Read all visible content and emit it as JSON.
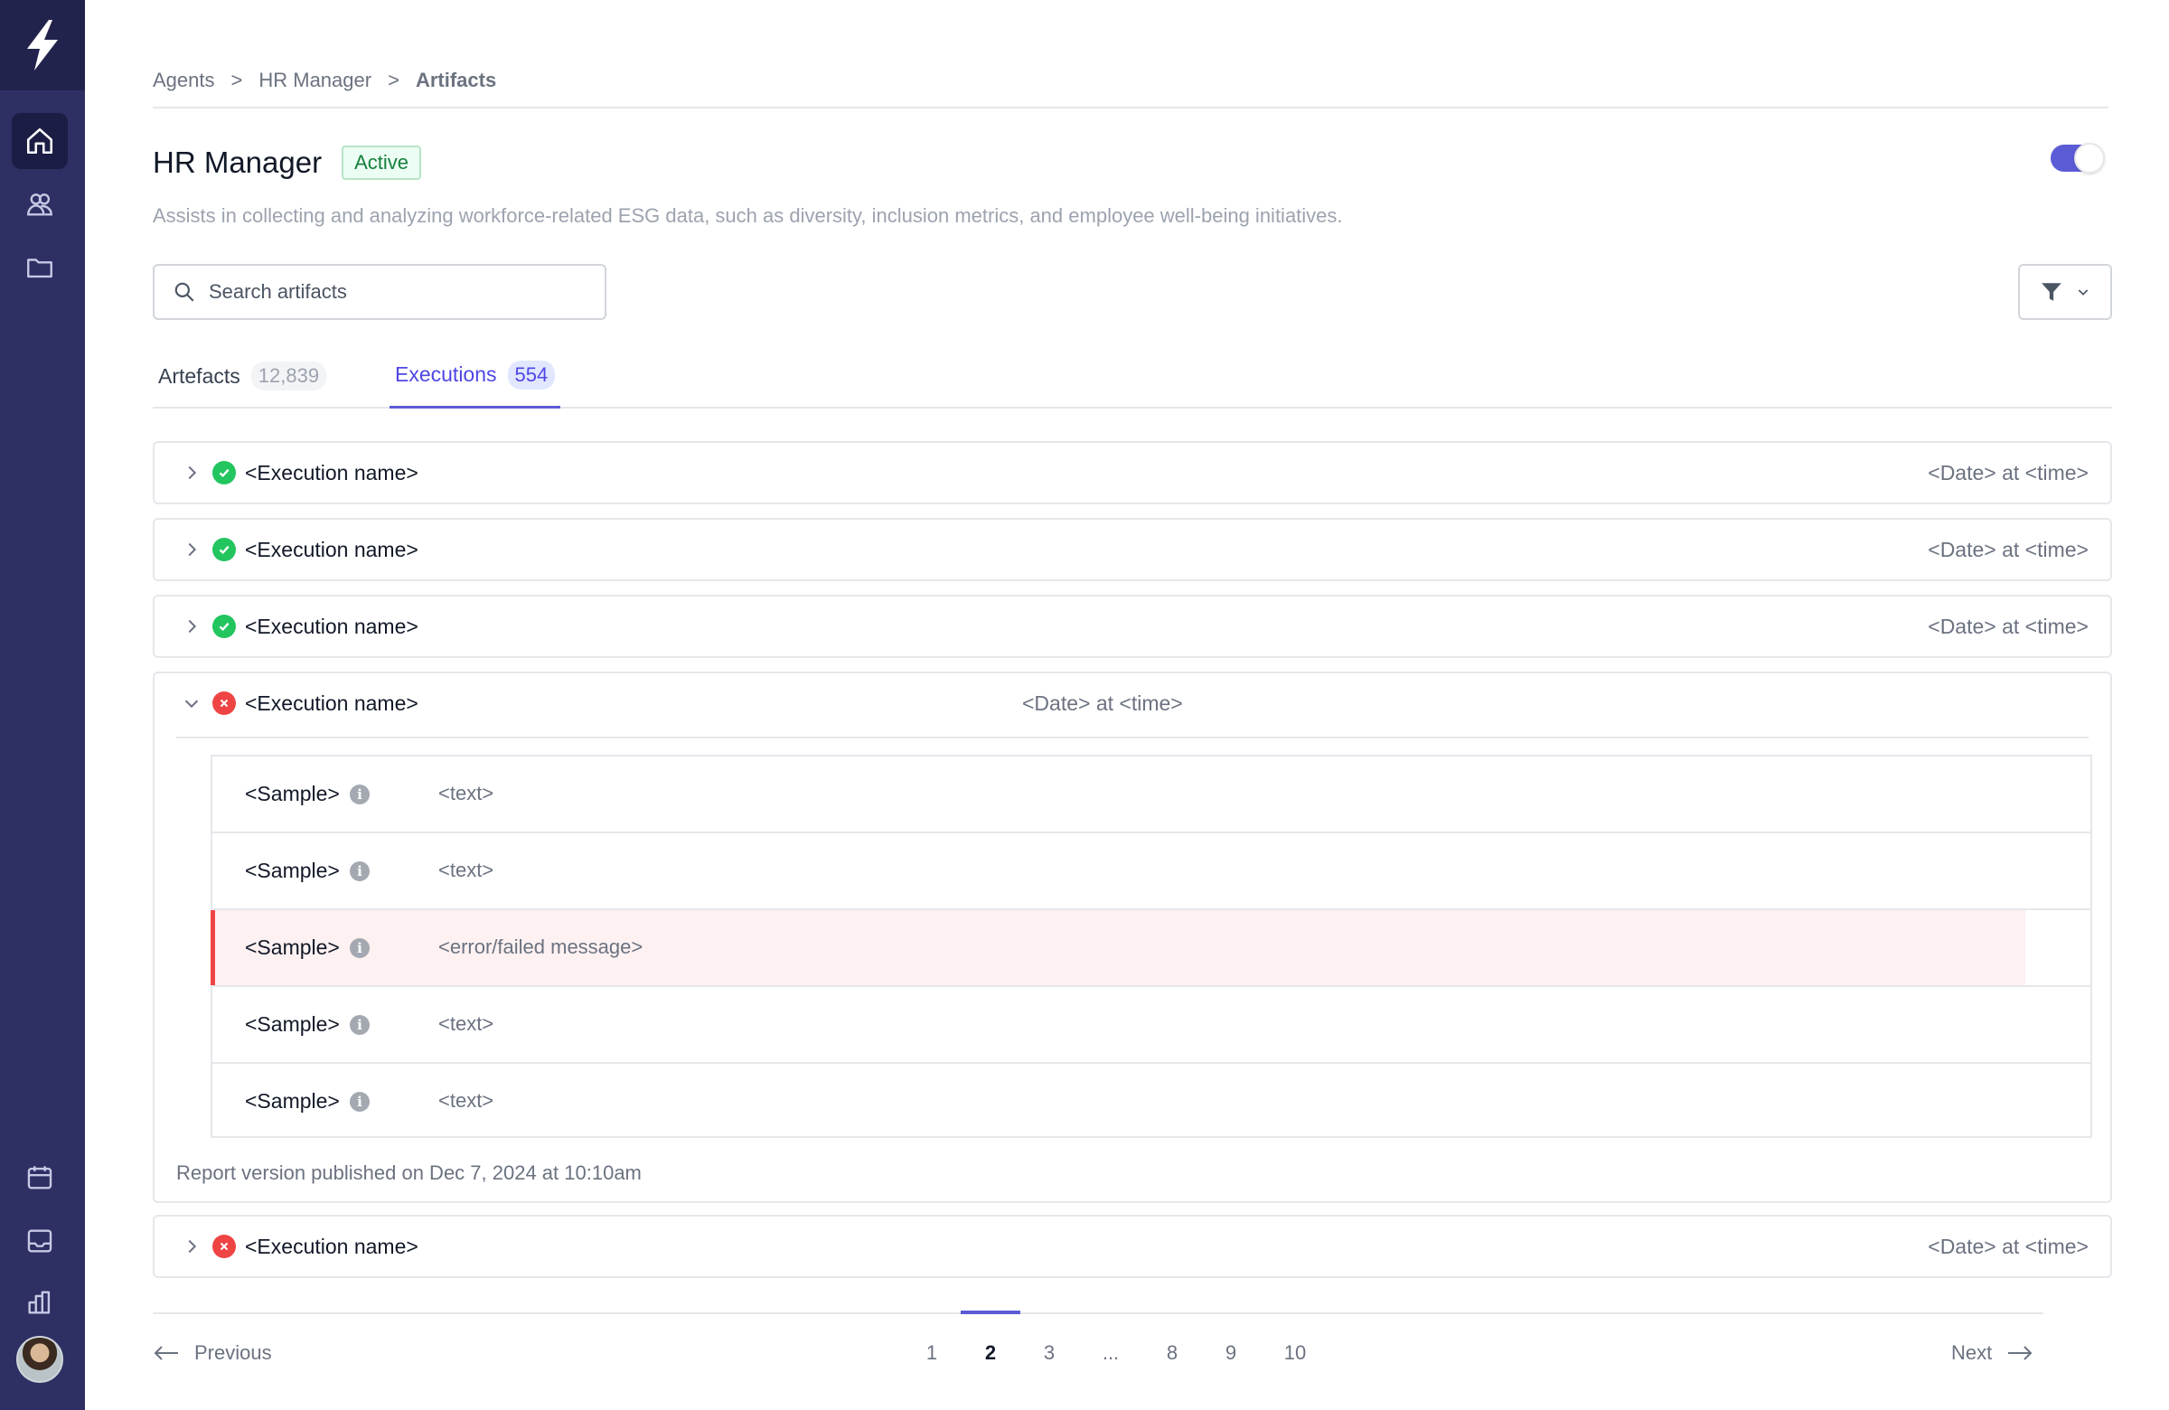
{
  "breadcrumb": [
    "Agents",
    "HR Manager",
    "Artifacts"
  ],
  "breadcrumb_separator": ">",
  "page": {
    "title": "HR Manager",
    "status_badge": "Active",
    "description": "Assists in collecting and analyzing workforce-related ESG data, such as diversity, inclusion metrics, and employee well-being initiatives.",
    "agent_enabled": true
  },
  "search": {
    "placeholder": "Search artifacts",
    "value": ""
  },
  "tabs": [
    {
      "label": "Artefacts",
      "count": "12,839",
      "active": false
    },
    {
      "label": "Executions",
      "count": "554",
      "active": true
    }
  ],
  "executions": [
    {
      "name": "<Execution name>",
      "date": "<Date> at <time>",
      "status": "success",
      "expanded": false
    },
    {
      "name": "<Execution name>",
      "date": "<Date> at <time>",
      "status": "success",
      "expanded": false
    },
    {
      "name": "<Execution name>",
      "date": "<Date> at <time>",
      "status": "success",
      "expanded": false
    },
    {
      "name": "<Execution name>",
      "date": "<Date> at <time>",
      "status": "failed",
      "expanded": true,
      "samples": [
        {
          "label": "<Sample>",
          "value": "<text>",
          "error": false
        },
        {
          "label": "<Sample>",
          "value": "<text>",
          "error": false
        },
        {
          "label": "<Sample>",
          "value": "<error/failed message>",
          "error": true
        },
        {
          "label": "<Sample>",
          "value": "<text>",
          "error": false
        },
        {
          "label": "<Sample>",
          "value": "<text>",
          "error": false
        }
      ],
      "report_note": "Report version published on Dec 7, 2024 at 10:10am"
    },
    {
      "name": "<Execution name>",
      "date": "<Date> at <time>",
      "status": "failed",
      "expanded": false
    }
  ],
  "pagination": {
    "previous_label": "Previous",
    "next_label": "Next",
    "pages": [
      "1",
      "2",
      "3",
      "...",
      "8",
      "9",
      "10"
    ],
    "current": "2"
  },
  "colors": {
    "sidebar": "#2e2f63",
    "accent": "#5b5bd6",
    "success": "#22c55e",
    "error": "#ef4444",
    "error_row_bg": "#fdf1f1"
  },
  "icons": {
    "sidebar_top": [
      "home-icon",
      "users-icon",
      "folder-icon"
    ],
    "sidebar_bottom": [
      "calendar-icon",
      "inbox-icon",
      "bar-chart-icon"
    ]
  }
}
